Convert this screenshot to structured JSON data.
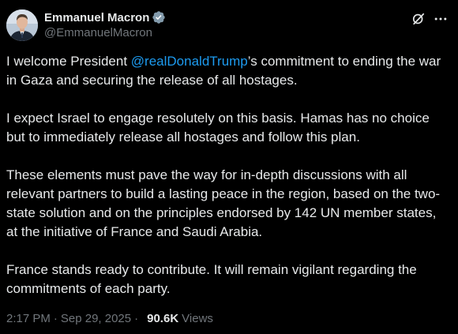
{
  "author": {
    "display_name": "Emmanuel Macron",
    "handle": "@EmmanuelMacron"
  },
  "icons": {
    "verified": "verified-badge-icon",
    "grok": "grok-icon",
    "more": "more-options-icon"
  },
  "colors": {
    "background": "#000000",
    "text": "#e7e9ea",
    "secondary": "#71767b",
    "link": "#1d9bf0"
  },
  "tweet": {
    "p1_before": "I welcome President ",
    "p1_mention": "@realDonaldTrump",
    "p1_after": "’s commitment to ending the war in Gaza and securing the release of all hostages.",
    "p2": "I expect Israel to engage resolutely on this basis. Hamas has no choice but to immediately release all hostages and follow this plan.",
    "p3": "These elements must pave the way for in-depth discussions with all relevant partners to build a lasting peace in the region, based on the two-state solution and on the principles endorsed by 142 UN member states, at the initiative of France and Saudi Arabia.",
    "p4": "France stands ready to contribute. It will remain vigilant regarding the commitments of each party."
  },
  "meta": {
    "time": "2:17 PM",
    "separator": "·",
    "date": "Sep 29, 2025",
    "views_count": "90.6K",
    "views_label": "Views"
  }
}
